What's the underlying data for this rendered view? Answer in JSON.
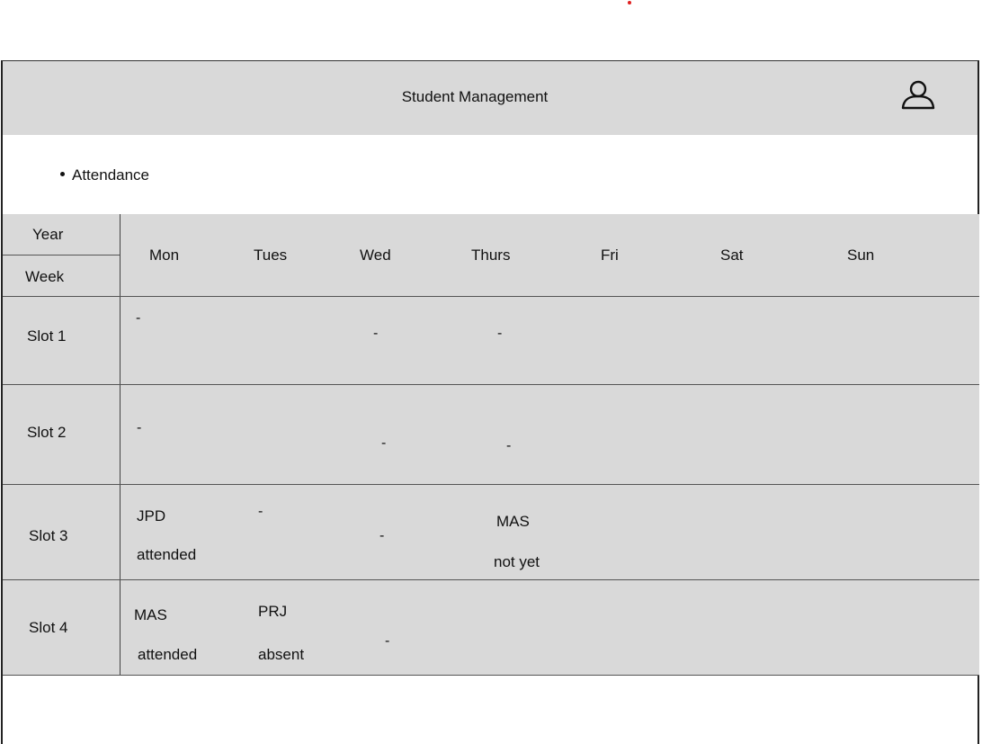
{
  "app": {
    "title": "Student Management"
  },
  "section": {
    "label": "Attendance"
  },
  "table": {
    "corner_top": "Year",
    "corner_bottom": "Week",
    "days": [
      "Mon",
      "Tues",
      "Wed",
      "Thurs",
      "Fri",
      "Sat",
      "Sun"
    ],
    "slots": [
      "Slot 1",
      "Slot 2",
      "Slot 3",
      "Slot 4"
    ],
    "dash": "-",
    "slot3": {
      "mon_course": "JPD",
      "mon_status": "attended",
      "thurs_course": "MAS",
      "thurs_status": "not yet"
    },
    "slot4": {
      "mon_course": "MAS",
      "mon_status": "attended",
      "tues_course": "PRJ",
      "tues_status": "absent"
    }
  },
  "colors": {
    "header_bg": "#d9d9d9",
    "grid_bg": "#d9d9d9",
    "accent_dot": "#e02020"
  },
  "icons": {
    "user": "user-icon"
  }
}
